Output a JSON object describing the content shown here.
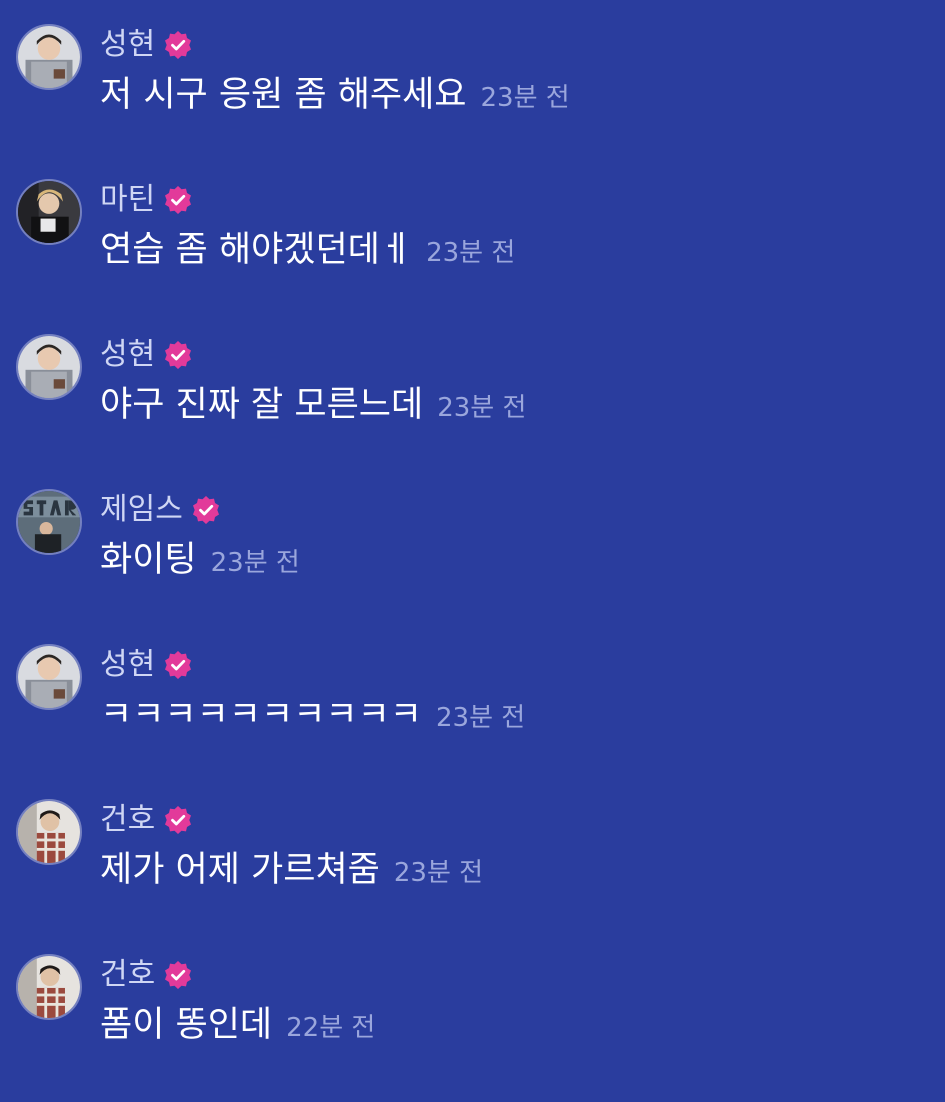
{
  "colors": {
    "background": "#2a3d9e",
    "name": "#cfd6f4",
    "message": "#ffffff",
    "timestamp": "#9aa6dc",
    "verified_badge": "#e23a9a"
  },
  "messages": [
    {
      "author": "성현",
      "verified": true,
      "avatar": "avatar-seonghyeon",
      "text": "저 시구 응원 좀 해주세요",
      "time": "23분 전"
    },
    {
      "author": "마틴",
      "verified": true,
      "avatar": "avatar-martin",
      "text": "연습 좀 해야겠던데ㅔ",
      "time": "23분 전"
    },
    {
      "author": "성현",
      "verified": true,
      "avatar": "avatar-seonghyeon",
      "text": "야구 진짜 잘 모른느데",
      "time": "23분 전"
    },
    {
      "author": "제임스",
      "verified": true,
      "avatar": "avatar-james",
      "text": "화이팅",
      "time": "23분 전"
    },
    {
      "author": "성현",
      "verified": true,
      "avatar": "avatar-seonghyeon",
      "text": "ㅋㅋㅋㅋㅋㅋㅋㅋㅋㅋ",
      "time": "23분 전"
    },
    {
      "author": "건호",
      "verified": true,
      "avatar": "avatar-geonho",
      "text": "제가 어제 가르쳐줌",
      "time": "23분 전"
    },
    {
      "author": "건호",
      "verified": true,
      "avatar": "avatar-geonho",
      "text": "폼이 똥인데",
      "time": "22분 전"
    }
  ]
}
